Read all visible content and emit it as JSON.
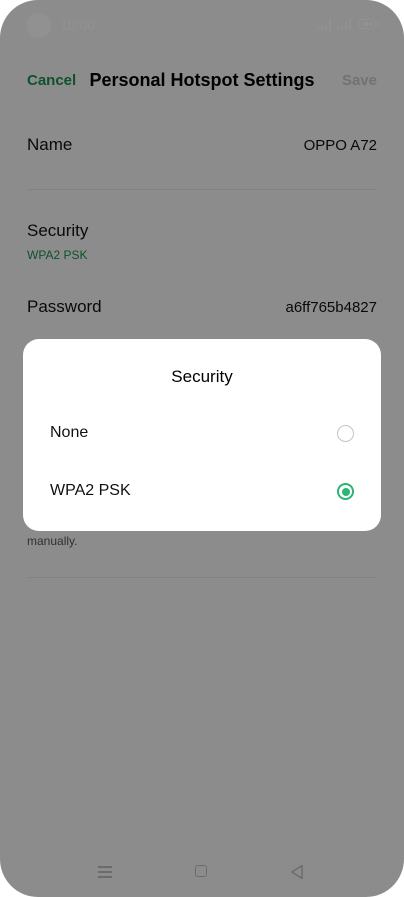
{
  "status_bar": {
    "time": "10:00"
  },
  "header": {
    "cancel_label": "Cancel",
    "title": "Personal Hotspot Settings",
    "save_label": "Save"
  },
  "settings": {
    "name_label": "Name",
    "name_value": "OPPO A72",
    "security_label": "Security",
    "security_value": "WPA2 PSK",
    "password_label": "Password",
    "password_value": "a6ff765b4827",
    "footnote": "manually."
  },
  "dialog": {
    "title": "Security",
    "options": [
      {
        "label": "None",
        "selected": false
      },
      {
        "label": "WPA2 PSK",
        "selected": true
      }
    ]
  },
  "colors": {
    "accent": "#1a8f4a",
    "radio_selected": "#2bb573"
  },
  "nav_bar": {
    "icons": [
      "menu-icon",
      "home-icon",
      "back-icon"
    ]
  }
}
